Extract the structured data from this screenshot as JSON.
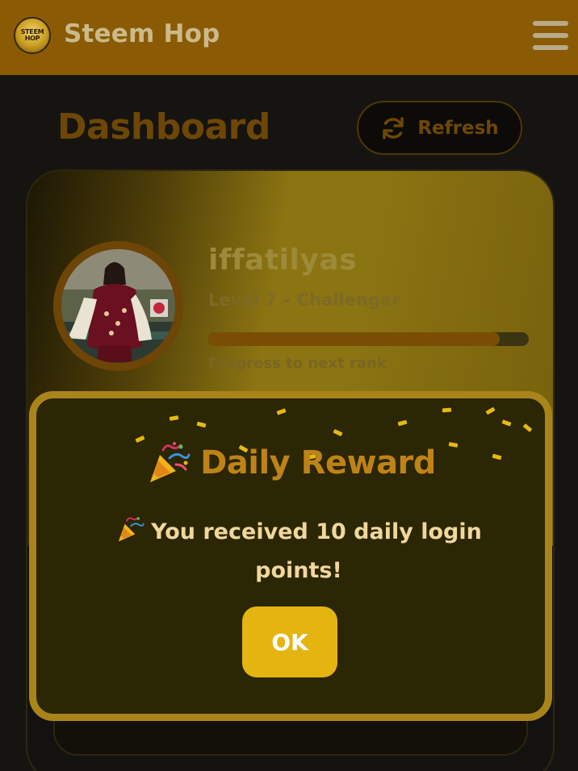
{
  "header": {
    "logo_text_line1": "STEEM",
    "logo_text_line2": "HOP",
    "app_title": "Steem Hop",
    "menu_icon": "hamburger-menu-icon"
  },
  "dashboard": {
    "title": "Dashboard",
    "refresh_label": "Refresh",
    "refresh_icon": "refresh-icon"
  },
  "profile": {
    "username": "iffatilyas",
    "level": "Level 7 – Challenger",
    "progress_fraction": 0.91,
    "progress_label": "Progress to next rank"
  },
  "modal": {
    "title": "Daily Reward",
    "title_icon": "party-popper-icon",
    "message": "You received 10 daily login points!",
    "ok_label": "OK"
  },
  "colors": {
    "header_bg": "#8a5a05",
    "accent_gold": "#e4b411",
    "modal_border": "#a9841a",
    "title_brown": "#6e4706"
  }
}
